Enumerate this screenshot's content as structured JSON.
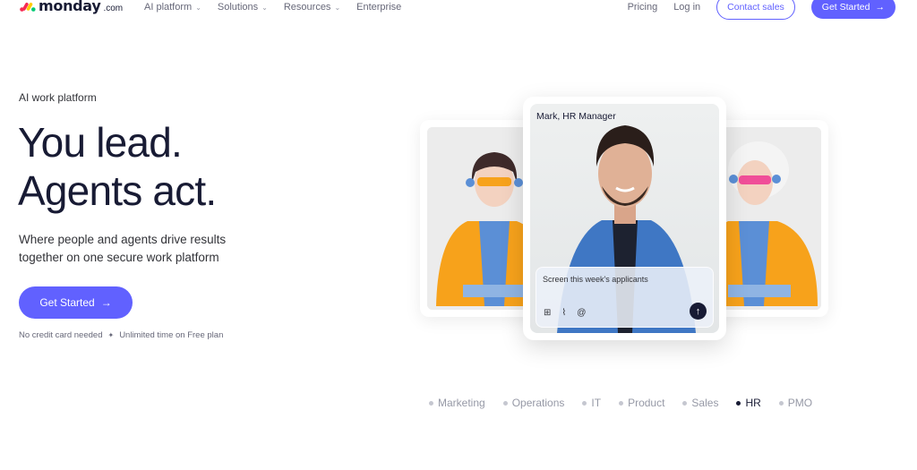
{
  "brand": {
    "name": "monday",
    "suffix": ".com",
    "colors": {
      "accent": "#6161ff",
      "text": "#181b34"
    }
  },
  "nav": {
    "links": [
      {
        "label": "AI platform",
        "has_dropdown": true
      },
      {
        "label": "Solutions",
        "has_dropdown": true
      },
      {
        "label": "Resources",
        "has_dropdown": true
      },
      {
        "label": "Enterprise",
        "has_dropdown": false
      }
    ],
    "pricing": "Pricing",
    "login": "Log in",
    "contact_sales": "Contact sales",
    "get_started": "Get Started"
  },
  "hero": {
    "eyebrow": "AI work platform",
    "headline_line1": "You lead.",
    "headline_line2": "Agents act.",
    "subheadline": "Where people and agents drive results together on one secure work platform",
    "cta": "Get Started",
    "fineprint_1": "No credit card needed",
    "fineprint_2": "Unlimited time on Free plan"
  },
  "showcase": {
    "persona": "Mark, HR Manager",
    "prompt": "Screen this week's applicants",
    "prompt_icons": [
      "apps-icon",
      "paperclip-icon",
      "at-icon"
    ],
    "tabs": [
      {
        "label": "Marketing",
        "active": false
      },
      {
        "label": "Operations",
        "active": false
      },
      {
        "label": "IT",
        "active": false
      },
      {
        "label": "Product",
        "active": false
      },
      {
        "label": "Sales",
        "active": false
      },
      {
        "label": "HR",
        "active": true
      },
      {
        "label": "PMO",
        "active": false
      }
    ]
  }
}
